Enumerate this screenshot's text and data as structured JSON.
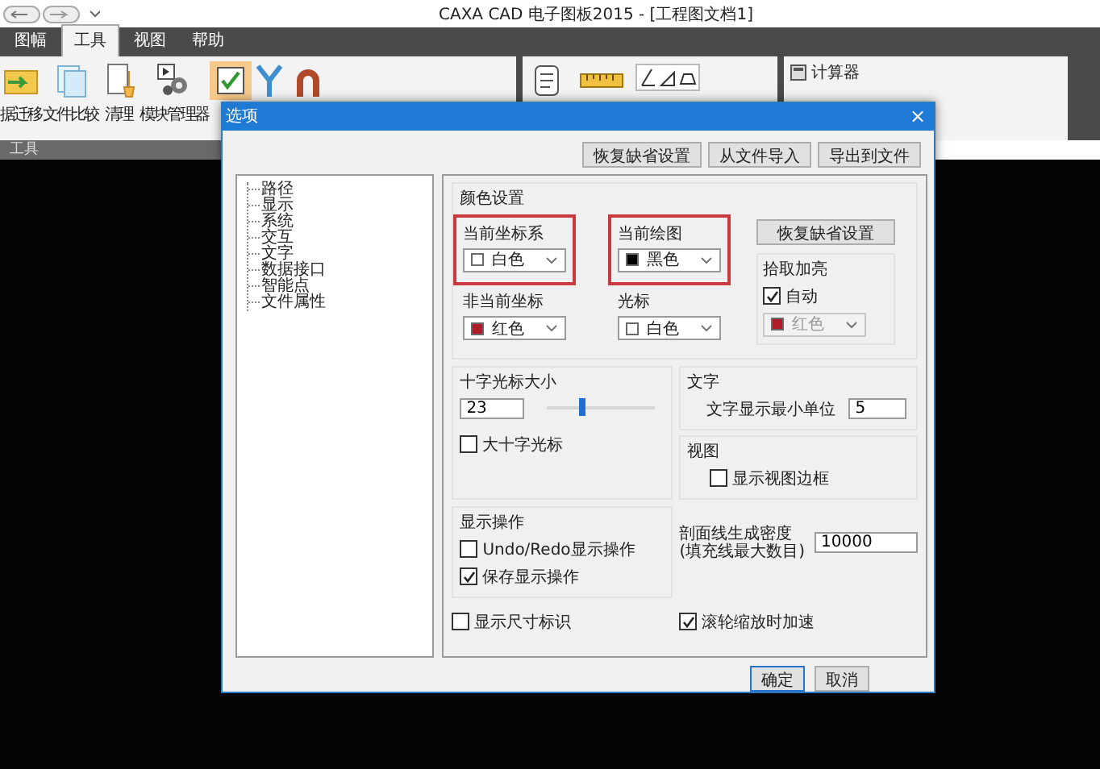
{
  "app": {
    "title": "CAXA CAD 电子图板2015 - [工程图文档1]",
    "menu_tabs": [
      {
        "label": "图幅",
        "selected": false
      },
      {
        "label": "工具",
        "selected": true
      },
      {
        "label": "视图",
        "selected": false
      },
      {
        "label": "帮助",
        "selected": false
      }
    ],
    "ribbon_items": [
      {
        "label": "据迁移",
        "kind": "folder"
      },
      {
        "label": "文件比较",
        "kind": "docs"
      },
      {
        "label": "清理",
        "kind": "broom"
      },
      {
        "label": "模块管理器",
        "kind": "gears"
      }
    ],
    "side_tools": [
      "计算器"
    ],
    "panel_label": "工具"
  },
  "dialog": {
    "title": "选项",
    "close": "×",
    "top_buttons": [
      "恢复缺省设置",
      "从文件导入",
      "导出到文件"
    ],
    "tree": [
      "路径",
      "显示",
      "系统",
      "交互",
      "文字",
      "数据接口",
      "智能点",
      "文件属性"
    ],
    "colors": {
      "title": "颜色设置",
      "pickers": [
        {
          "label": "当前坐标系",
          "value": "白色",
          "color": "#ffffff",
          "highlighted": true
        },
        {
          "label": "当前绘图",
          "value": "黑色",
          "color": "#000000",
          "highlighted": true
        },
        {
          "label": "非当前坐标",
          "value": "红色",
          "color": "#b01c28",
          "highlighted": false
        },
        {
          "label": "光标",
          "value": "白色",
          "color": "#ffffff",
          "highlighted": false
        }
      ],
      "reset_button": "恢复缺省设置",
      "pick": {
        "title": "拾取加亮",
        "auto": {
          "label": "自动",
          "checked": true
        },
        "value": "红色",
        "color": "#b01c28",
        "disabled": true
      }
    },
    "cursor": {
      "title": "十字光标大小",
      "value": "23",
      "level": 0.32,
      "big": {
        "label": "大十字光标",
        "checked": false
      }
    },
    "text": {
      "title": "文字",
      "label": "文字显示最小单位",
      "value": "5"
    },
    "view": {
      "title": "视图",
      "border": {
        "label": "显示视图边框",
        "checked": false
      }
    },
    "ops": {
      "title": "显示操作",
      "items": [
        {
          "label": "Undo/Redo显示操作",
          "checked": false
        },
        {
          "label": "保存显示操作",
          "checked": true
        }
      ]
    },
    "hatch": {
      "label": "剖面线生成密度\n(填充线最大数目)",
      "value": "10000"
    },
    "dims": {
      "label": "显示尺寸标识",
      "checked": false
    },
    "wheel": {
      "label": "滚轮缩放时加速",
      "checked": true
    },
    "ok": "确定",
    "cancel": "取消"
  }
}
